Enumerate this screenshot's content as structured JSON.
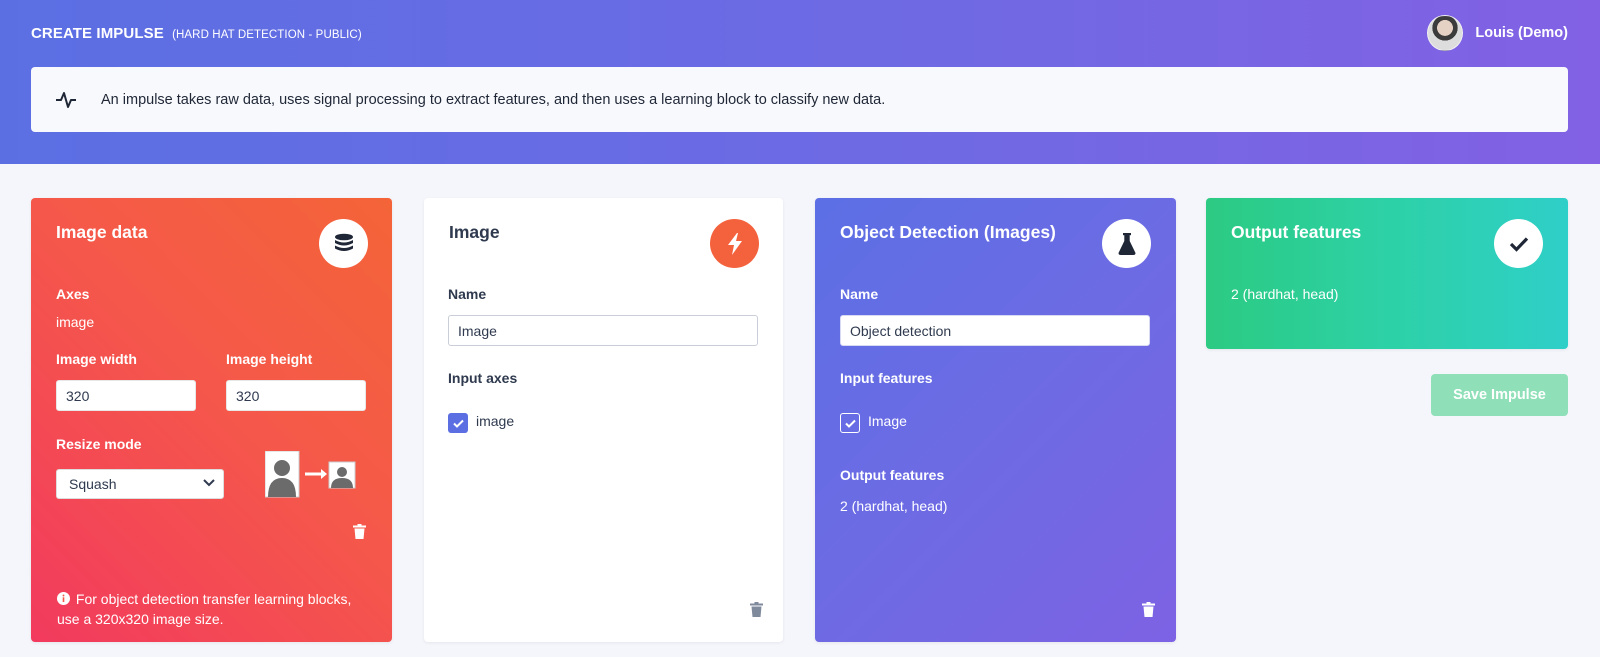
{
  "header": {
    "title": "CREATE IMPULSE",
    "subtitle": "(HARD HAT DETECTION - PUBLIC)",
    "user_name": "Louis (Demo)"
  },
  "info": {
    "text": "An impulse takes raw data, uses signal processing to extract features, and then uses a learning block to classify new data."
  },
  "image_data_block": {
    "title": "Image data",
    "axes_label": "Axes",
    "axes_value": "image",
    "width_label": "Image width",
    "width_value": "320",
    "height_label": "Image height",
    "height_value": "320",
    "resize_label": "Resize mode",
    "resize_value": "Squash",
    "note": "For object detection transfer learning blocks, use a 320x320 image size."
  },
  "processing_block": {
    "title": "Image",
    "name_label": "Name",
    "name_value": "Image",
    "input_axes_label": "Input axes",
    "axis_item": "image",
    "axis_checked": true
  },
  "learning_block": {
    "title": "Object Detection (Images)",
    "name_label": "Name",
    "name_value": "Object detection",
    "input_features_label": "Input features",
    "feature_item": "Image",
    "feature_checked": true,
    "output_features_label": "Output features",
    "output_features_value": "2 (hardhat, head)"
  },
  "output_block": {
    "title": "Output features",
    "value": "2 (hardhat, head)"
  },
  "actions": {
    "save_label": "Save Impulse"
  },
  "colors": {
    "header_start": "#5b6fe3",
    "header_end": "#8261e4",
    "input_block": "#f5584a",
    "processing_icon": "#f4623d",
    "learning_block": "#6d6be4",
    "output_block": "#2dd1a6",
    "checkbox": "#5b6fe3",
    "save_button": "#8fe0b8"
  },
  "icons": {
    "info_banner": "pulse-icon",
    "image_data": "database-icon",
    "processing": "lightning-icon",
    "learning": "flask-icon",
    "output": "checkmark-icon",
    "delete": "trash-icon"
  }
}
